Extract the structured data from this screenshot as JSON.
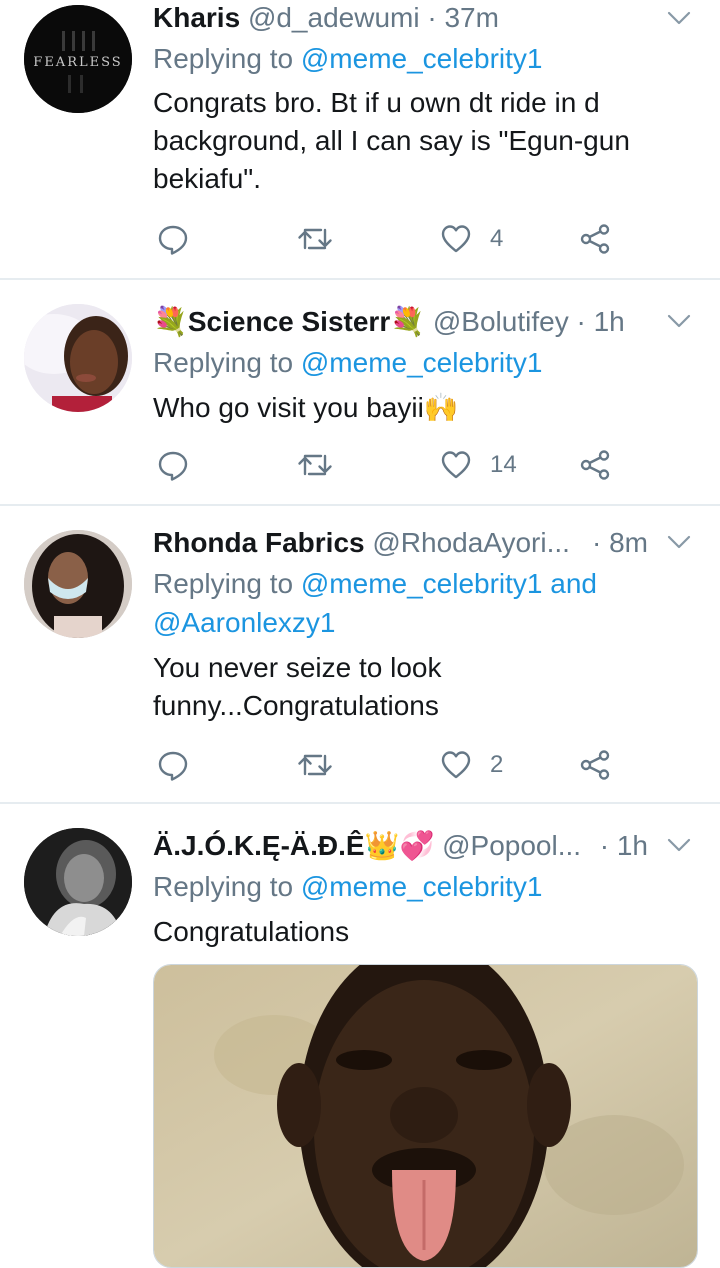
{
  "tweets": [
    {
      "name": "Kharis",
      "handle": "@d_adewumi",
      "time": "37m",
      "replying_prefix": "Replying to",
      "replying_to": "@meme_celebrity1",
      "text_lines": [
        "Congrats bro. Bt if u own dt ride in d",
        "background, all I can say is \"Egun-gun",
        "bekiafu\"."
      ],
      "likes": "4",
      "avatar_text": "FEARLESS"
    },
    {
      "name": "Science Sisterr",
      "name_emoji": "💐",
      "handle": "@Bolutifey",
      "time": "1h",
      "replying_prefix": "Replying to",
      "replying_to": "@meme_celebrity1",
      "text": "Who go visit you bayii",
      "text_emoji": "🙌",
      "likes": "14"
    },
    {
      "name": "Rhonda Fabrics",
      "handle": "@RhodaAyori...",
      "time": "8m",
      "replying_prefix": "Replying to",
      "replying_to": "@meme_celebrity1",
      "replying_and": "and",
      "replying_to_2": "@Aaronlexzy1",
      "text_lines": [
        "You never seize to look",
        "funny...Congratulations"
      ],
      "likes": "2"
    },
    {
      "name": "Ä.J.Ó.K.Ę-Ä.Đ.Ê",
      "name_emoji": "👑💞",
      "handle": "@Popool...",
      "time": "1h",
      "replying_prefix": "Replying to",
      "replying_to": "@meme_celebrity1",
      "text": "Congratulations"
    }
  ],
  "separator": "·",
  "icons": {
    "reply": "reply-icon",
    "retweet": "retweet-icon",
    "like": "heart-icon",
    "share": "share-icon",
    "more": "chevron-down-icon"
  },
  "colors": {
    "link": "#1b95e0",
    "muted": "#657786",
    "text": "#14171a",
    "divider": "#e6ecf0"
  }
}
